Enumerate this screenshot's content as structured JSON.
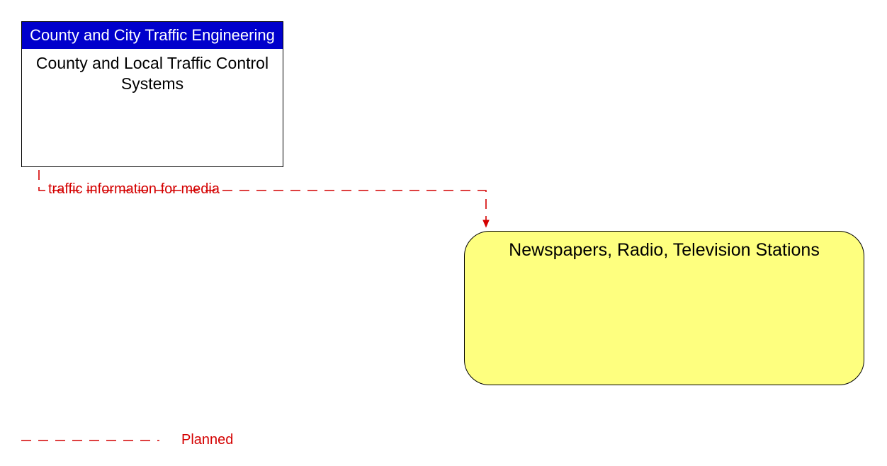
{
  "nodes": {
    "source": {
      "header": "County and City Traffic Engineering",
      "body": "County and Local Traffic Control Systems"
    },
    "target": {
      "label": "Newspapers, Radio, Television Stations"
    }
  },
  "flow": {
    "label": "traffic information for media"
  },
  "legend": {
    "planned": "Planned"
  },
  "colors": {
    "header_bg": "#0000cc",
    "target_bg": "#feff7f",
    "flow_line": "#d40000"
  }
}
